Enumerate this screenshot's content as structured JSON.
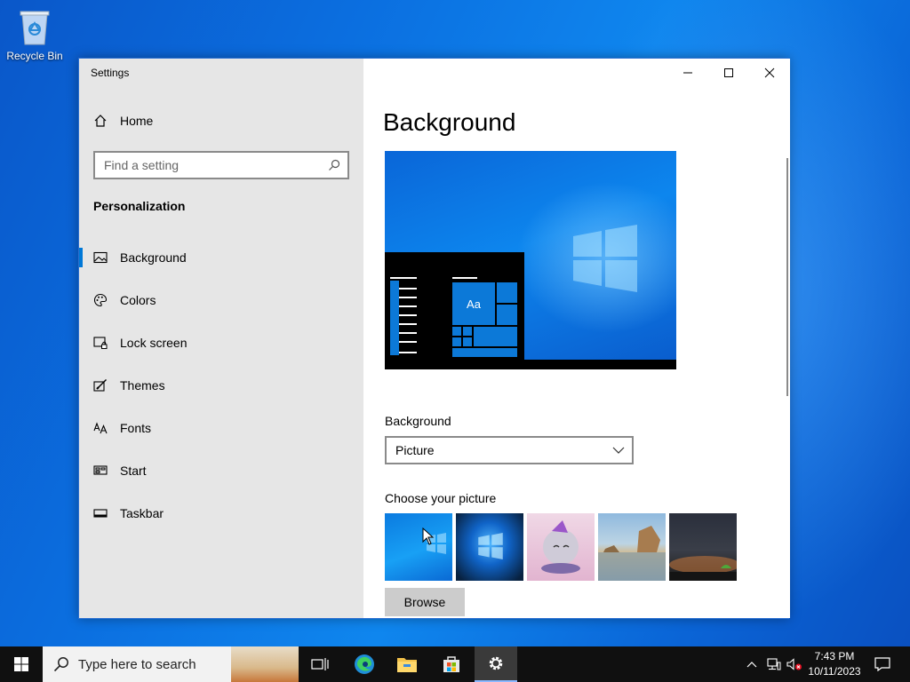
{
  "desktop": {
    "recycle_bin_label": "Recycle Bin"
  },
  "window": {
    "title": "Settings",
    "controls": {
      "minimize": "minimize-icon",
      "maximize": "maximize-icon",
      "close": "close-icon"
    }
  },
  "sidebar": {
    "home_label": "Home",
    "search_placeholder": "Find a setting",
    "section_title": "Personalization",
    "items": [
      {
        "label": "Background",
        "icon": "image-icon",
        "active": true
      },
      {
        "label": "Colors",
        "icon": "palette-icon",
        "active": false
      },
      {
        "label": "Lock screen",
        "icon": "lock-screen-icon",
        "active": false
      },
      {
        "label": "Themes",
        "icon": "themes-icon",
        "active": false
      },
      {
        "label": "Fonts",
        "icon": "fonts-icon",
        "active": false
      },
      {
        "label": "Start",
        "icon": "start-icon",
        "active": false
      },
      {
        "label": "Taskbar",
        "icon": "taskbar-icon",
        "active": false
      }
    ]
  },
  "main": {
    "title": "Background",
    "preview_tile_text": "Aa",
    "background_label": "Background",
    "background_value": "Picture",
    "choose_picture_label": "Choose your picture",
    "browse_label": "Browse"
  },
  "taskbar": {
    "search_placeholder": "Type here to search",
    "time": "7:43 PM",
    "date": "10/11/2023"
  },
  "colors": {
    "accent": "#0078d7",
    "sidebar_bg": "#e6e6e6",
    "taskbar_bg": "#101010"
  }
}
